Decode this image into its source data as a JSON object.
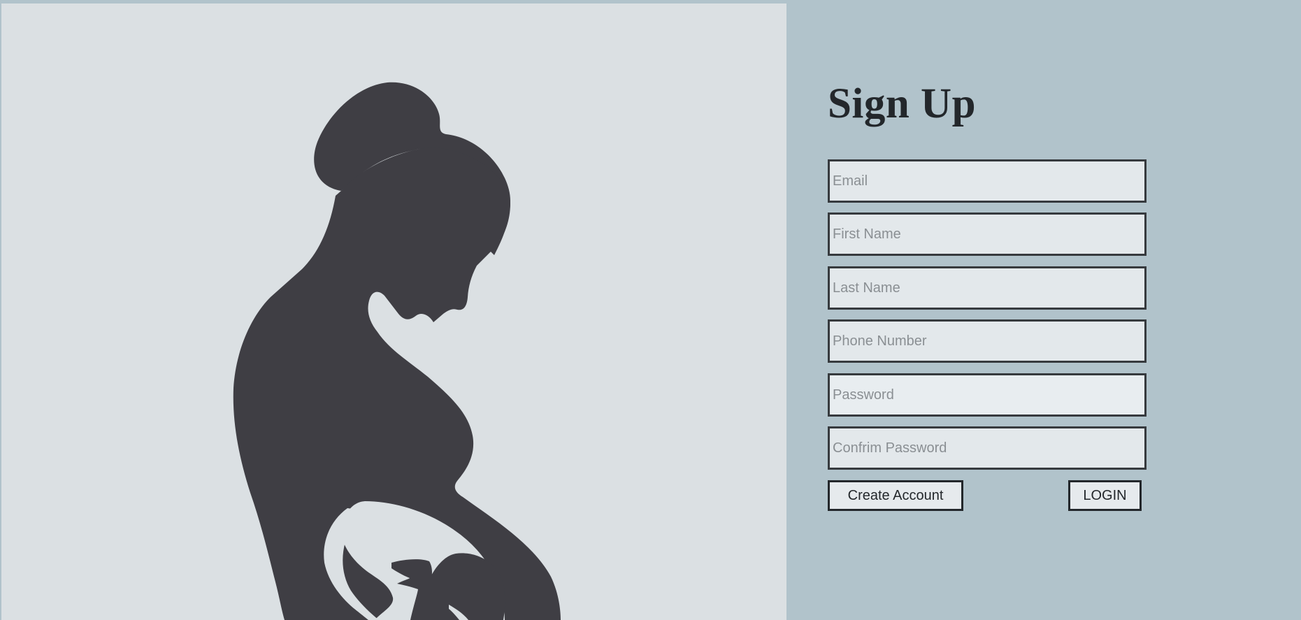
{
  "form": {
    "title": "Sign Up",
    "email": {
      "placeholder": "Email",
      "value": ""
    },
    "first_name": {
      "placeholder": "First Name",
      "value": ""
    },
    "last_name": {
      "placeholder": "Last Name",
      "value": ""
    },
    "phone": {
      "placeholder": "Phone Number",
      "value": ""
    },
    "password": {
      "placeholder": "Password",
      "value": ""
    },
    "confirm_password": {
      "placeholder": "Confrim Password",
      "value": ""
    },
    "create_account_label": "Create Account",
    "login_label": "LOGIN"
  },
  "illustration": {
    "subject": "pregnant-woman-silhouette",
    "color": "#3f3e44",
    "background": "#dbe0e3"
  }
}
